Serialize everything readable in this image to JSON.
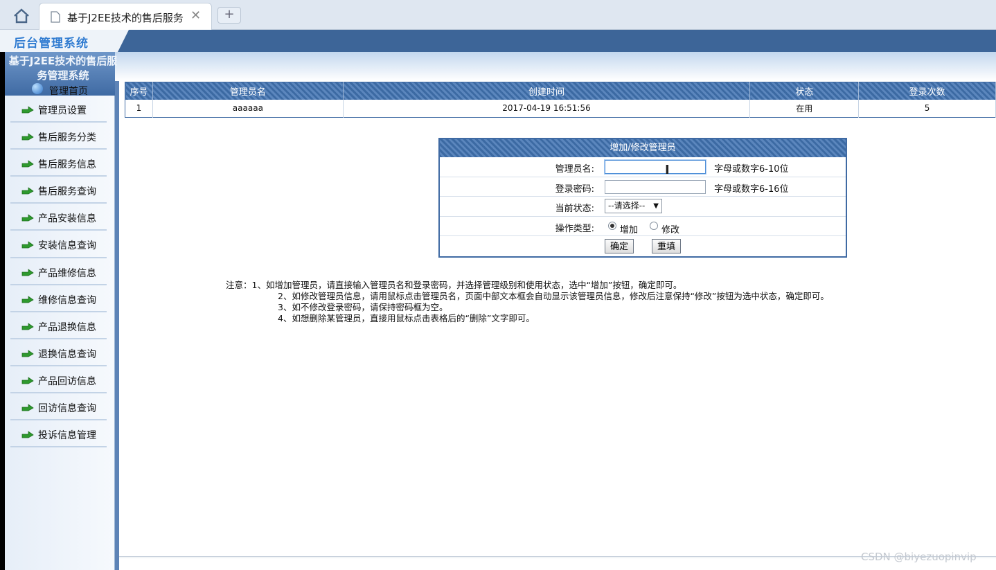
{
  "browser": {
    "tab_title": "基于J2EE技术的售后服务",
    "new_tab_label": "+",
    "close_label": "✕"
  },
  "app": {
    "logo_text": "后台管理系统",
    "system_title_line1": "基于J2EE技术的售后服",
    "system_title_line2": "务管理系统",
    "home_label": "管理首页"
  },
  "sidebar": {
    "items": [
      {
        "label": "管理员设置"
      },
      {
        "label": "售后服务分类"
      },
      {
        "label": "售后服务信息"
      },
      {
        "label": "售后服务查询"
      },
      {
        "label": "产品安装信息"
      },
      {
        "label": "安装信息查询"
      },
      {
        "label": "产品维修信息"
      },
      {
        "label": "维修信息查询"
      },
      {
        "label": "产品退换信息"
      },
      {
        "label": "退换信息查询"
      },
      {
        "label": "产品回访信息"
      },
      {
        "label": "回访信息查询"
      },
      {
        "label": "投诉信息管理"
      }
    ]
  },
  "table": {
    "headers": [
      "序号",
      "管理员名",
      "创建时间",
      "状态",
      "登录次数"
    ],
    "rows": [
      {
        "index": "1",
        "name": "aaaaaa",
        "created": "2017-04-19 16:51:56",
        "status": "在用",
        "logins": "5"
      }
    ]
  },
  "form": {
    "title": "增加/修改管理员",
    "name_label": "管理员名:",
    "name_value": "",
    "name_hint": "字母或数字6-10位",
    "password_label": "登录密码:",
    "password_value": "",
    "password_hint": "字母或数字6-16位",
    "status_label": "当前状态:",
    "status_selected": "--请选择--",
    "optype_label": "操作类型:",
    "optype_add": "增加",
    "optype_edit": "修改",
    "confirm_label": "确定",
    "reset_label": "重填"
  },
  "notes": {
    "line1": "注意：1、如增加管理员，请直接输入管理员名和登录密码，并选择管理级别和使用状态，选中“增加”按钮，确定即可。",
    "line2": "2、如修改管理员信息，请用鼠标点击管理员名，页面中部文本框会自动显示该管理员信息，修改后注意保持“修改”按钮为选中状态，确定即可。",
    "line3": "3、如不修改登录密码，请保持密码框为空。",
    "line4": "4、如想删除某管理员，直接用鼠标点击表格后的“删除”文字即可。"
  },
  "watermark": "CSDN @biyezuopinvip",
  "colors": {
    "header_blue": "#3d6598",
    "sidebar_bg": "#e6eef8",
    "arrow_green": "#2e9a2e"
  }
}
